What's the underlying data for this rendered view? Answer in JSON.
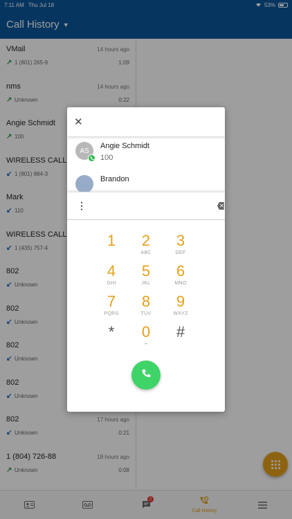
{
  "status": {
    "time": "7:11 AM",
    "date": "Thu Jul 18",
    "battery": "53%"
  },
  "header": {
    "title": "Call History"
  },
  "calls": [
    {
      "name": "VMail",
      "number": "1 (801) 265-9",
      "when": "14 hours ago",
      "duration": "1:09",
      "direction": "outgoing"
    },
    {
      "name": "nms",
      "number": "Unknown",
      "when": "14 hours ago",
      "duration": "0:22",
      "direction": "outgoing"
    },
    {
      "name": "Angie Schmidt",
      "number": "100",
      "when": "",
      "duration": "",
      "direction": "outgoing"
    },
    {
      "name": "WIRELESS CALLER",
      "number": "1 (801) 884-3",
      "when": "",
      "duration": "",
      "direction": "incoming"
    },
    {
      "name": "Mark",
      "number": "110",
      "when": "",
      "duration": "",
      "direction": "incoming"
    },
    {
      "name": "WIRELESS CALLER",
      "number": "1 (435) 757-4",
      "when": "",
      "duration": "",
      "direction": "incoming"
    },
    {
      "name": "802",
      "number": "Unknown",
      "when": "",
      "duration": "",
      "direction": "incoming"
    },
    {
      "name": "802",
      "number": "Unknown",
      "when": "",
      "duration": "",
      "direction": "incoming"
    },
    {
      "name": "802",
      "number": "Unknown",
      "when": "",
      "duration": "",
      "direction": "incoming"
    },
    {
      "name": "802",
      "number": "Unknown",
      "when": "",
      "duration": "",
      "direction": "incoming"
    },
    {
      "name": "802",
      "number": "Unknown",
      "when": "17 hours ago",
      "duration": "0:21",
      "direction": "incoming"
    },
    {
      "name": "1 (804) 726-88",
      "number": "Unknown",
      "when": "18 hours ago",
      "duration": "0:08",
      "direction": "outgoing"
    }
  ],
  "dialog": {
    "close_icon": "close-icon",
    "contacts": [
      {
        "initials": "AS",
        "name": "Angie Schmidt",
        "number": "100"
      },
      {
        "initials": "",
        "name": "Brandon",
        "number": ""
      }
    ],
    "input_value": "",
    "keys": [
      {
        "digit": "1",
        "letters": ""
      },
      {
        "digit": "2",
        "letters": "ABC"
      },
      {
        "digit": "3",
        "letters": "DEF"
      },
      {
        "digit": "4",
        "letters": "GHI"
      },
      {
        "digit": "5",
        "letters": "JKL"
      },
      {
        "digit": "6",
        "letters": "MNO"
      },
      {
        "digit": "7",
        "letters": "PQRS"
      },
      {
        "digit": "8",
        "letters": "TUV"
      },
      {
        "digit": "9",
        "letters": "WXYZ"
      },
      {
        "digit": "*",
        "letters": ""
      },
      {
        "digit": "0",
        "letters": "+"
      },
      {
        "digit": "#",
        "letters": ""
      }
    ]
  },
  "tabs": [
    {
      "name": "contacts",
      "icon": "contacts-card-icon",
      "label": ""
    },
    {
      "name": "voicemail",
      "icon": "voicemail-icon",
      "label": ""
    },
    {
      "name": "messages",
      "icon": "chat-icon",
      "label": "",
      "badge": "2"
    },
    {
      "name": "call-history",
      "icon": "call-history-icon",
      "label": "Call History"
    },
    {
      "name": "menu",
      "icon": "menu-icon",
      "label": ""
    }
  ],
  "colors": {
    "primary": "#0a579c",
    "accent": "#e5a01a",
    "call_green": "#3ed468",
    "outgoing": "#2e9e4a",
    "incoming": "#1d63c0"
  }
}
